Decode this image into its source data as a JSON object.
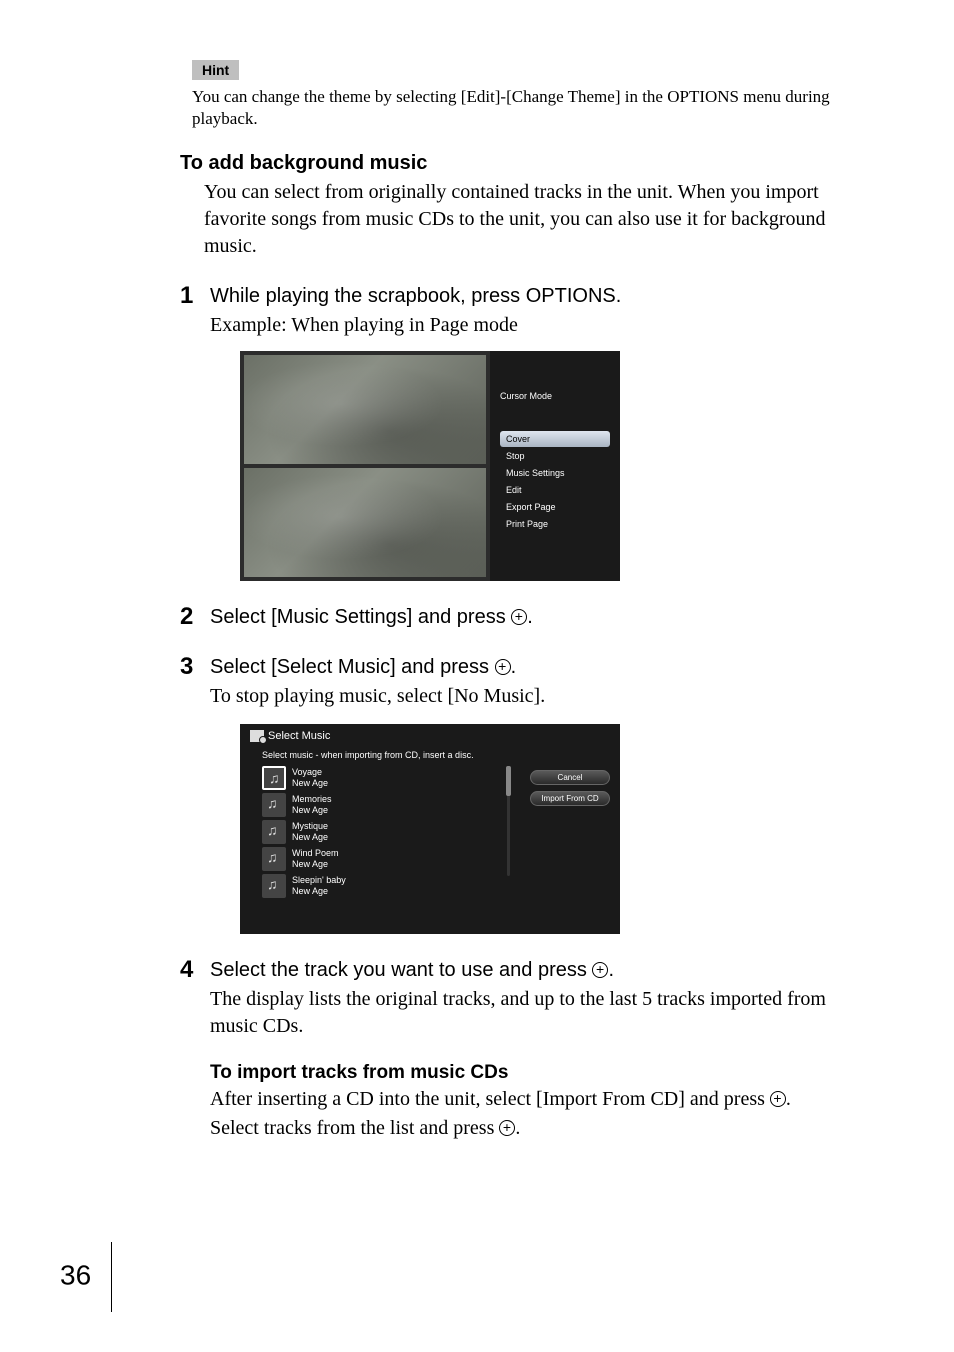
{
  "hint": {
    "label": "Hint",
    "text": "You can change the theme by selecting [Edit]-[Change Theme] in the OPTIONS menu during playback."
  },
  "section_heading": "To add background music",
  "intro_text": "You can select from originally contained tracks in the unit. When you import favorite songs from music CDs to the unit, you can also use it for background music.",
  "steps": {
    "s1": {
      "num": "1",
      "title": "While playing the scrapbook, press OPTIONS.",
      "note": "Example: When playing in Page mode"
    },
    "s2": {
      "num": "2",
      "title_pre": "Select [Music Settings] and press ",
      "title_post": "."
    },
    "s3": {
      "num": "3",
      "title_pre": "Select [Select Music] and press ",
      "title_post": ".",
      "note": "To stop playing music, select [No Music]."
    },
    "s4": {
      "num": "4",
      "title_pre": "Select the track you want to use and press ",
      "title_post": ".",
      "note": "The display lists the original tracks, and up to the last 5 tracks imported from music CDs.",
      "subhead": "To import tracks from music CDs",
      "after1_pre": "After inserting a CD into the unit, select [Import From CD] and press ",
      "after1_post": ".",
      "after2_pre": "Select tracks from the list and press ",
      "after2_post": "."
    }
  },
  "shot1": {
    "cursor_mode": "Cursor Mode",
    "menu": {
      "cover": "Cover",
      "stop": "Stop",
      "music_settings": "Music Settings",
      "edit": "Edit",
      "export_page": "Export Page",
      "print_page": "Print Page"
    }
  },
  "shot2": {
    "title": "Select Music",
    "caption": "Select music - when importing from CD, insert a disc.",
    "tracks": [
      {
        "name": "Voyage",
        "genre": "New Age"
      },
      {
        "name": "Memories",
        "genre": "New Age"
      },
      {
        "name": "Mystique",
        "genre": "New Age"
      },
      {
        "name": "Wind Poem",
        "genre": "New Age"
      },
      {
        "name": "Sleepin' baby",
        "genre": "New Age"
      }
    ],
    "buttons": {
      "cancel": "Cancel",
      "import": "Import From CD"
    }
  },
  "page_number": "36"
}
